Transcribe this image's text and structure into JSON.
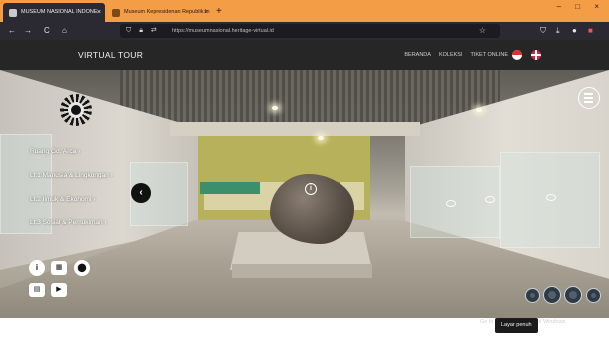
{
  "browser": {
    "tabs": [
      {
        "label": "MUSEUM NASIONAL INDONE",
        "close": "×"
      },
      {
        "label": "Museum Kepresidenan Republik In",
        "close": "×"
      }
    ],
    "new_tab": "+",
    "window_controls": "–  □  ×",
    "url": "https://museumnasional.heritage-virtual.id",
    "nav_icons": {
      "back": "←",
      "forward": "→",
      "reload": "C",
      "home": "⌂",
      "star": "☆"
    },
    "toolbar_icons": [
      "shield-icon",
      "download-icon",
      "extension-icon",
      "profile-icon",
      "menu-icon"
    ]
  },
  "site": {
    "title": "VIRTUAL TOUR",
    "menu": [
      "BERANDA",
      "KOLEKSI",
      "TIKET ONLINE"
    ],
    "colors": {
      "header_bg": "#262626",
      "tab_bar": "#f39d47",
      "flag_red": "#e52d2d"
    }
  },
  "halls": [
    "Ruang Gd. Arca",
    "Lt.1 Manusia & Lingkungan",
    "Lt.2 Ilmuk & Ekonomi",
    "Lt.3 Sosial & Pemukiman"
  ],
  "controls": {
    "prev": "‹",
    "tools": [
      {
        "name": "info-button",
        "glyph": "i"
      },
      {
        "name": "gallery-button",
        "glyph": "▦"
      },
      {
        "name": "map-button",
        "glyph": "⬤"
      },
      {
        "name": "tour-button",
        "glyph": "▤"
      },
      {
        "name": "video-button",
        "glyph": "▶"
      }
    ]
  },
  "hotspot": {
    "info": "i"
  },
  "tooltip": "Layar penuh",
  "watermark": "Go to Settings to activate Windows."
}
